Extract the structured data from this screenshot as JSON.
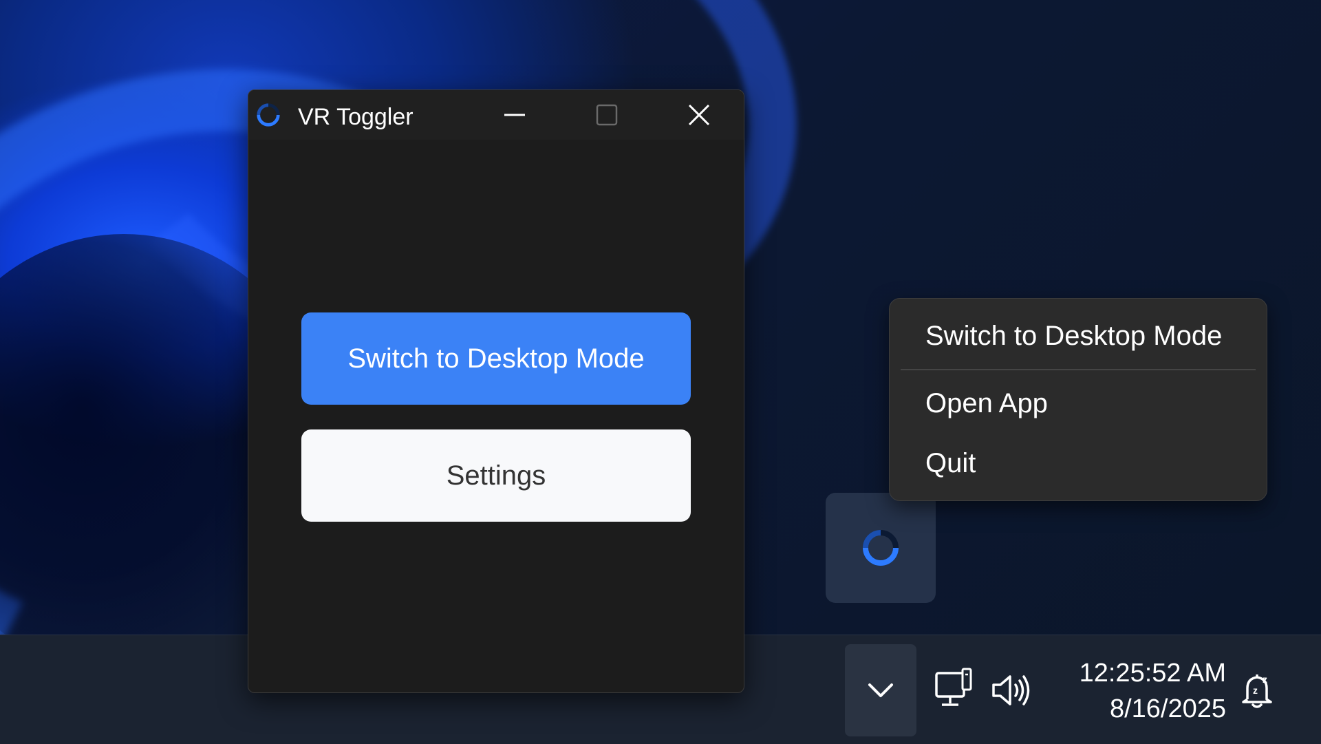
{
  "window": {
    "title": "VR Toggler",
    "icon": "ring-loader-icon"
  },
  "main": {
    "primary_button": "Switch to Desktop Mode",
    "settings_button": "Settings"
  },
  "context_menu": {
    "items": [
      {
        "label": "Switch to Desktop Mode"
      },
      {
        "label": "Open App"
      },
      {
        "label": "Quit"
      }
    ]
  },
  "taskbar": {
    "time": "12:25:52 AM",
    "date": "8/16/2025",
    "icons": [
      "chevron-up-icon",
      "network-icon",
      "volume-icon",
      "notification-icon"
    ]
  },
  "colors": {
    "accent": "#3b82f6",
    "window_bg": "#1c1c1c",
    "menu_bg": "#2b2b2b",
    "taskbar_bg": "#1b2331"
  }
}
